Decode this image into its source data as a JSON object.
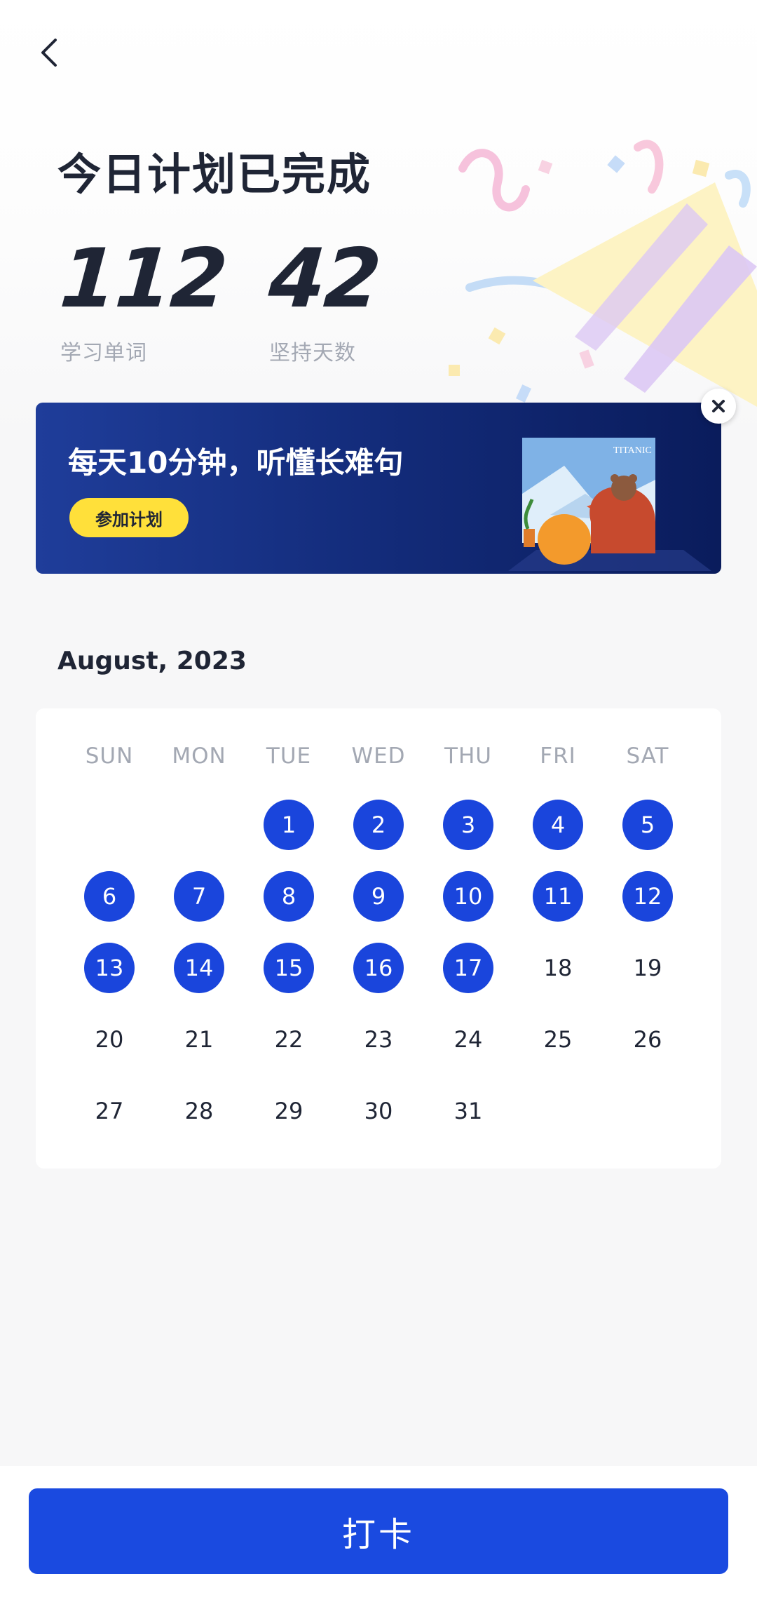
{
  "header": {
    "back_icon": "chevron-left-icon"
  },
  "summary": {
    "title": "今日计划已完成",
    "words_value": "112",
    "words_label": "学习单词",
    "days_value": "42",
    "days_label": "坚持天数"
  },
  "banner": {
    "text": "每天10分钟，听懂长难句",
    "button_label": "参加计划",
    "poster_text": "TITANIC",
    "close_icon": "close-icon"
  },
  "calendar": {
    "month_label": "August, 2023",
    "weekdays": [
      "SUN",
      "MON",
      "TUE",
      "WED",
      "THU",
      "FRI",
      "SAT"
    ],
    "first_weekday_index": 2,
    "days_in_month": 31,
    "completed_days": [
      1,
      2,
      3,
      4,
      5,
      6,
      7,
      8,
      9,
      10,
      11,
      12,
      13,
      14,
      15,
      16,
      17
    ]
  },
  "footer": {
    "checkin_label": "打卡"
  },
  "colors": {
    "accent": "#1a45dc",
    "banner_button": "#ffe03a",
    "muted_text": "#a3a8b3",
    "primary_text": "#1f2535"
  }
}
